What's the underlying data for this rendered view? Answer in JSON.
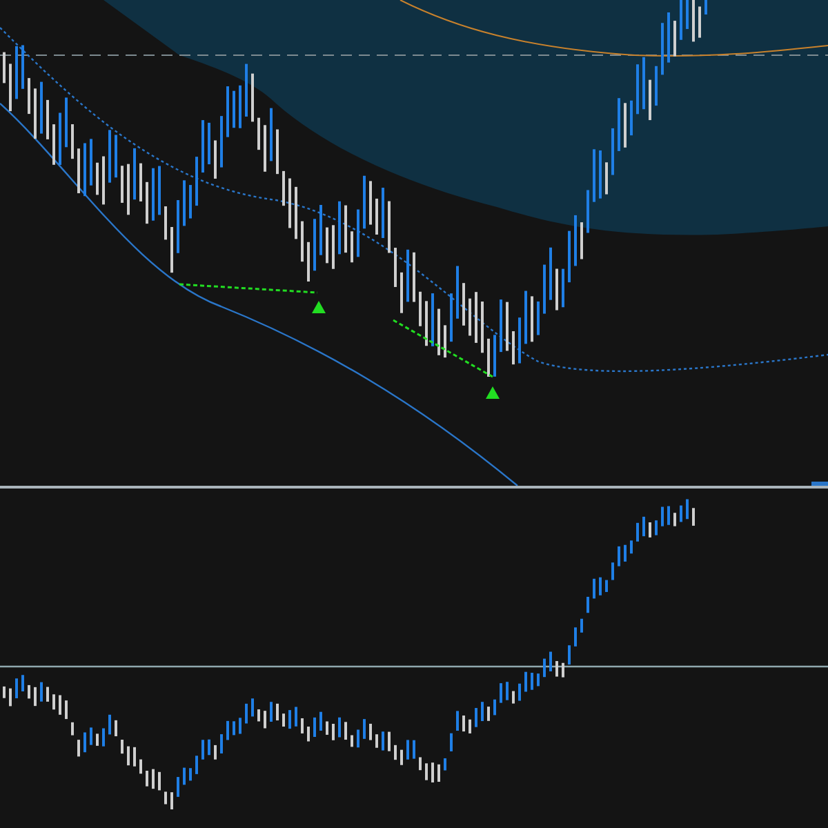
{
  "panels": [
    {
      "kind": "price"
    },
    {
      "kind": "oscillator"
    }
  ]
}
